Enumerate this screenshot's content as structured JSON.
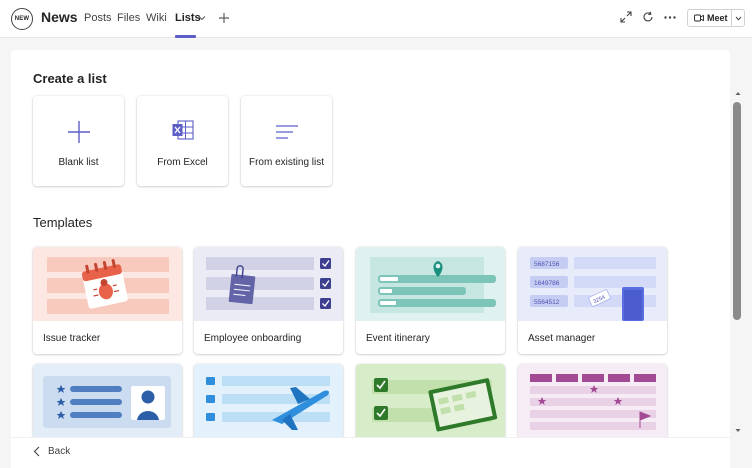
{
  "header": {
    "logo_text": "NEW",
    "title": "News",
    "tabs": [
      {
        "label": "Posts"
      },
      {
        "label": "Files"
      },
      {
        "label": "Wiki"
      },
      {
        "label": "Lists"
      }
    ],
    "meet_label": "Meet",
    "accent_color": "#5b5fc7"
  },
  "main": {
    "create_heading": "Create a list",
    "create_options": [
      {
        "label": "Blank list",
        "icon": "plus-icon"
      },
      {
        "label": "From Excel",
        "icon": "excel-icon"
      },
      {
        "label": "From existing list",
        "icon": "list-lines-icon"
      }
    ],
    "templates_heading": "Templates",
    "templates": [
      {
        "label": "Issue tracker"
      },
      {
        "label": "Employee onboarding"
      },
      {
        "label": "Event itinerary"
      },
      {
        "label": "Asset manager",
        "thumb_numbers": [
          "5687156",
          "1649786",
          "5564512",
          "3254"
        ]
      },
      {
        "label": ""
      },
      {
        "label": ""
      },
      {
        "label": ""
      },
      {
        "label": ""
      }
    ]
  },
  "footer": {
    "back_label": "Back"
  }
}
